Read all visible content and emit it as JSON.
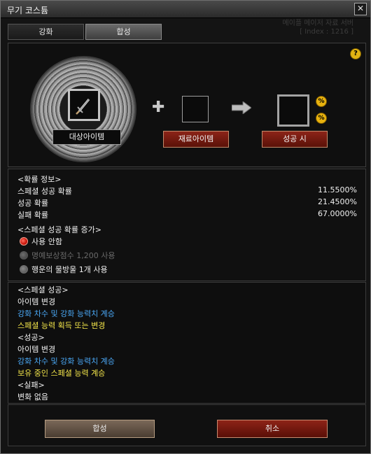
{
  "window": {
    "title": "무기 코스튬"
  },
  "tabs": [
    {
      "label": "강화"
    },
    {
      "label": "합성"
    }
  ],
  "watermark": {
    "line1": "메이플 메이저 자료 서버",
    "line2": "[ Index : 1216 ]"
  },
  "slots": {
    "target_label": "대상아이템",
    "material_button": "재료아이템",
    "success_button": "성공 시",
    "help": "?",
    "percent": "%"
  },
  "probability": {
    "header": "<확률 정보>",
    "rows": [
      {
        "label": "스페셜 성공 확률",
        "value": "11.5500%"
      },
      {
        "label": "성공 확률",
        "value": "21.4500%"
      },
      {
        "label": "실패 확률",
        "value": "67.0000%"
      }
    ],
    "boost_header": "<스페셜 성공 확률 증가>",
    "options": [
      {
        "label": "사용 안함",
        "state": "selected"
      },
      {
        "label": "명예보상점수 1,200 사용",
        "state": "disabled"
      },
      {
        "label": "행운의 물방울 1개 사용",
        "state": "unselected"
      }
    ]
  },
  "results": {
    "special_header": "<스페셜 성공>",
    "special_lines": [
      {
        "text": "아이템 변경",
        "color": "#f0f0f0"
      },
      {
        "text": "강화 차수 및 강화 능력치 계승",
        "color": "#4aa8f5"
      },
      {
        "text": "스페셜 능력 획득 또는 변경",
        "color": "#f3e54a"
      }
    ],
    "success_header": "<성공>",
    "success_lines": [
      {
        "text": "아이템 변경",
        "color": "#f0f0f0"
      },
      {
        "text": "강화 차수 및 강화 능력치 계승",
        "color": "#4aa8f5"
      },
      {
        "text": "보유 중인 스페셜 능력 계승",
        "color": "#f3e54a"
      }
    ],
    "fail_header": "<실패>",
    "fail_lines": [
      {
        "text": "변화 없음",
        "color": "#f0f0f0"
      }
    ]
  },
  "buttons": {
    "compose": "합성",
    "cancel": "취소"
  }
}
